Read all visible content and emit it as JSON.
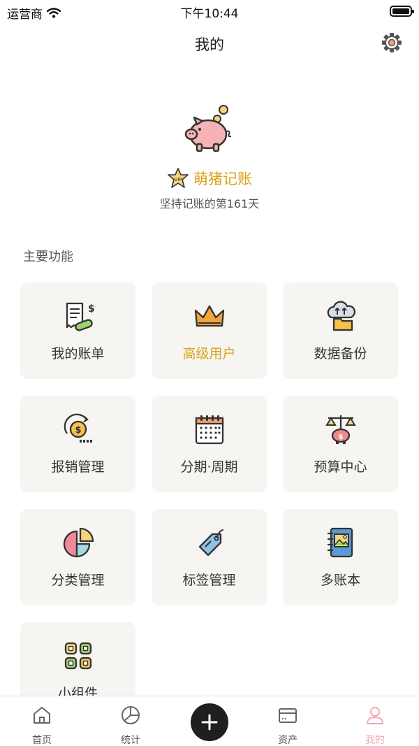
{
  "status_bar": {
    "carrier": "运营商",
    "time": "下午10:44"
  },
  "header": {
    "title": "我的"
  },
  "profile": {
    "name": "萌猪记账",
    "streak_text": "坚持记账的第161天"
  },
  "main_features": {
    "section_title": "主要功能",
    "items": [
      {
        "label": "我的账单",
        "icon": "receipt-icon"
      },
      {
        "label": "高级用户",
        "icon": "crown-icon",
        "highlight": true
      },
      {
        "label": "数据备份",
        "icon": "cloud-backup-icon"
      },
      {
        "label": "报销管理",
        "icon": "coin-refund-icon"
      },
      {
        "label": "分期·周期",
        "icon": "calendar-icon"
      },
      {
        "label": "预算中心",
        "icon": "budget-scale-icon"
      },
      {
        "label": "分类管理",
        "icon": "pie-chart-icon"
      },
      {
        "label": "标签管理",
        "icon": "tag-icon"
      },
      {
        "label": "多账本",
        "icon": "notebook-icon"
      },
      {
        "label": "小组件",
        "icon": "widget-icon"
      }
    ]
  },
  "tab_bar": {
    "tabs": [
      {
        "label": "首页",
        "icon": "home-icon"
      },
      {
        "label": "统计",
        "icon": "chart-icon"
      },
      {
        "label": "",
        "icon": "plus-icon"
      },
      {
        "label": "资产",
        "icon": "wallet-icon"
      },
      {
        "label": "我的",
        "icon": "user-icon",
        "active": true
      }
    ]
  },
  "colors": {
    "accent_gold": "#d9a21b",
    "active_pink": "#f4a7b3",
    "card_bg": "#f6f5f2",
    "add_button": "#1f1f1f"
  }
}
